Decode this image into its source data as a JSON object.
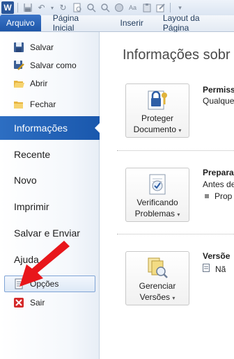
{
  "tabs": {
    "file": "Arquivo",
    "home": "Página Inicial",
    "insert": "Inserir",
    "layout": "Layout da Página"
  },
  "backstage": {
    "save": "Salvar",
    "save_as": "Salvar como",
    "open": "Abrir",
    "close": "Fechar",
    "info": "Informações",
    "recent": "Recente",
    "new": "Novo",
    "print": "Imprimir",
    "save_send": "Salvar e Enviar",
    "help": "Ajuda",
    "options": "Opções",
    "exit": "Sair"
  },
  "info": {
    "title": "Informações sobr",
    "protect_label_1": "Proteger",
    "protect_label_2": "Documento",
    "permissions_title": "Permiss",
    "permissions_desc": "Qualque",
    "check_label_1": "Verificando",
    "check_label_2": "Problemas",
    "prepare_title": "Prepara",
    "prepare_desc": "Antes de",
    "prepare_bullet": "Prop",
    "manage_label_1": "Gerenciar",
    "manage_label_2": "Versões",
    "versions_title": "Versõe",
    "versions_bullet": "Nã"
  },
  "colors": {
    "file_tab": "#2a63b8",
    "selected_nav": "#1f5fb3",
    "arrow": "#e8161b"
  }
}
